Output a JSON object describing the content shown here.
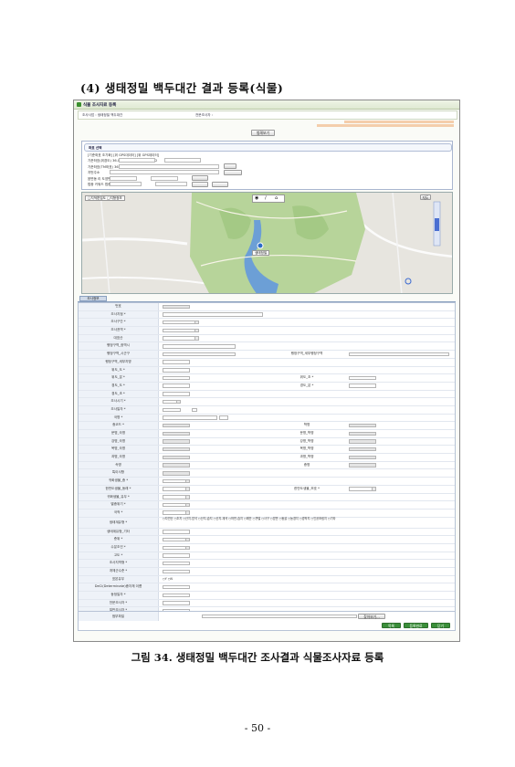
{
  "doc": {
    "section_heading": "(4) 생태정밀 백두대간 결과 등록(식물)",
    "caption": "그림 34. 생태정밀 백두대간 조사결과 식물조사자료 등록",
    "page_number": "- 50 -"
  },
  "screen": {
    "window_title": "식물 조사자료 등록",
    "header_left": "조사사업 : 생태정밀 백두대간",
    "header_right": "전문조사자 : ",
    "notice_line1": "",
    "notice_line2": "",
    "view_button": "범례보기",
    "info_panel_title": "좌표 선택",
    "coord_lines": [
      "[기준좌표 조기화] [위 GPS데이터] [위 GPS데이터]",
      "기준좌표(위경도)  36.0029897  /  126.7499902",
      "기준좌표(TM좌표)  36  2  1  3.6029999999  126  44",
      "지번주소",
      "읍면동         리          도엽번호",
      "법종 키워드       법종 코드       법종찾기"
    ],
    "map_checks": [
      "지적편집도",
      "지형정보"
    ],
    "map_zoom_btn": "지도",
    "map_pin_label": "생태정밀",
    "tab_label": "조사정보",
    "rows": [
      {
        "label": "번호",
        "label2": ""
      },
      {
        "label": "조사지점 *",
        "label2": ""
      },
      {
        "label": "조사구간 *",
        "label2": ""
      },
      {
        "label": "조사권역 *",
        "label2": ""
      },
      {
        "label": "대표산",
        "label2": ""
      },
      {
        "label": "행정구역_광역시",
        "label2": ""
      },
      {
        "label": "행정구역_시군구",
        "label2": "행정구역_세부행정구역"
      },
      {
        "label": "행정구역_세부지명",
        "label2": ""
      },
      {
        "label": "위도_도 *",
        "label2": ""
      },
      {
        "label": "위도_분 *",
        "label2": "위도_초 *"
      },
      {
        "label": "경도_도 *",
        "label2": "경도_분 *"
      },
      {
        "label": "경도_초 *",
        "label2": ""
      },
      {
        "label": "조사시기 *",
        "label2": ""
      },
      {
        "label": "조사일자 *",
        "label2": ""
      },
      {
        "label": "국명 *",
        "label2": ""
      },
      {
        "label": "종코드 *",
        "label2": "학명"
      },
      {
        "label": "문명_국명",
        "label2": "문명_학명"
      },
      {
        "label": "강명_국명",
        "label2": "강명_학명"
      },
      {
        "label": "목명_국명",
        "label2": "목명_학명"
      },
      {
        "label": "과명_국명",
        "label2": "과명_학명"
      },
      {
        "label": "속명",
        "label2": "종명"
      },
      {
        "label": "특이사항",
        "label2": ""
      },
      {
        "label": "귀화생물_종 *",
        "label2": ""
      },
      {
        "label": "한반도생물_동래 *",
        "label2": "한반도생물_보호 *"
      },
      {
        "label": "귀화생물_유무 *",
        "label2": ""
      },
      {
        "label": "멸종위기 *",
        "label2": ""
      },
      {
        "label": "국적 *",
        "label2": ""
      },
      {
        "label": "생태계유형 *",
        "label2": ""
      },
      {
        "label": "생태계유형_기타",
        "label2": ""
      },
      {
        "label": "층위 *",
        "label2": ""
      },
      {
        "label": "수분조건 *",
        "label2": ""
      },
      {
        "label": "고도 *",
        "label2": ""
      },
      {
        "label": "조사지역형 *",
        "label2": ""
      },
      {
        "label": "개체군수준 *",
        "label2": ""
      },
      {
        "label": "표본유무",
        "label2": ""
      },
      {
        "label": "DeCi(Determinate)종자체 이름",
        "label2": ""
      },
      {
        "label": "동정일자 *",
        "label2": ""
      },
      {
        "label": "전문조사자 *",
        "label2": ""
      },
      {
        "label": "일반조사자 *",
        "label2": ""
      }
    ],
    "ecosystem_options": "○자연산  ○초지  ○산지-암석  ○산지-습지  ○산지-계곡  ○하천-습지  ○해안  ○갯벌  ○사구  ○암반  ○동굴  ○농경지  ○경작지  ○인공조림지  ○기타",
    "specimen_options": "○Y  ○N",
    "attach_label": "첨부파일",
    "find_button": "찾아보기...",
    "btn_list": "목록",
    "btn_save": "등록완료",
    "btn_close": "닫기"
  }
}
